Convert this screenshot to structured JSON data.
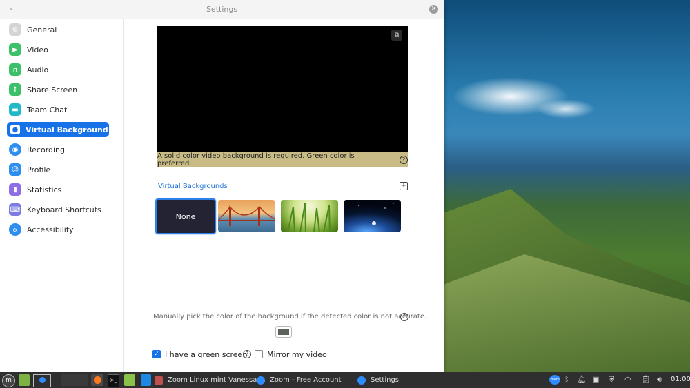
{
  "window": {
    "title": "Settings"
  },
  "sidebar": {
    "items": [
      {
        "label": "General",
        "icon": "gear-icon",
        "color": "#c8c8c8",
        "active": false
      },
      {
        "label": "Video",
        "icon": "video-camera-icon",
        "color": "#3cc06a",
        "active": false
      },
      {
        "label": "Audio",
        "icon": "headphones-icon",
        "color": "#3cc06a",
        "active": false
      },
      {
        "label": "Share Screen",
        "icon": "share-screen-icon",
        "color": "#3cc06a",
        "active": false
      },
      {
        "label": "Team Chat",
        "icon": "chat-bubble-icon",
        "color": "#21b8c8",
        "active": false
      },
      {
        "label": "Virtual Background",
        "icon": "person-card-icon",
        "color": "#ffffff",
        "active": true
      },
      {
        "label": "Recording",
        "icon": "record-icon",
        "color": "#2d8ef0",
        "active": false
      },
      {
        "label": "Profile",
        "icon": "person-icon",
        "color": "#2d8ef0",
        "active": false
      },
      {
        "label": "Statistics",
        "icon": "bar-chart-icon",
        "color": "#8e6ee6",
        "active": false
      },
      {
        "label": "Keyboard Shortcuts",
        "icon": "keyboard-icon",
        "color": "#7b7be0",
        "active": false
      },
      {
        "label": "Accessibility",
        "icon": "accessibility-icon",
        "color": "#2d8ef0",
        "active": false
      }
    ]
  },
  "main": {
    "notice": "A solid color video background is required. Green color is preferred.",
    "virtual_backgrounds_label": "Virtual Backgrounds",
    "backgrounds": [
      {
        "label": "None",
        "selected": true
      },
      {
        "label": "",
        "selected": false
      },
      {
        "label": "",
        "selected": false
      },
      {
        "label": "",
        "selected": false
      }
    ],
    "manual_pick_text": "Manually pick the color of the background if the detected color is not accurate.",
    "picked_color": "#5d625d",
    "green_screen_label": "I have a green screen",
    "green_screen_checked": true,
    "mirror_label": "Mirror my video",
    "mirror_checked": false
  },
  "taskbar": {
    "apps": [
      {
        "label": "Zoom Linux mint Vanessa ..."
      },
      {
        "label": "Zoom - Free Account"
      },
      {
        "label": "Settings"
      }
    ],
    "clock": "01:00"
  },
  "colors": {
    "accent": "#1672e6",
    "notice_bg": "#c9bb86"
  }
}
